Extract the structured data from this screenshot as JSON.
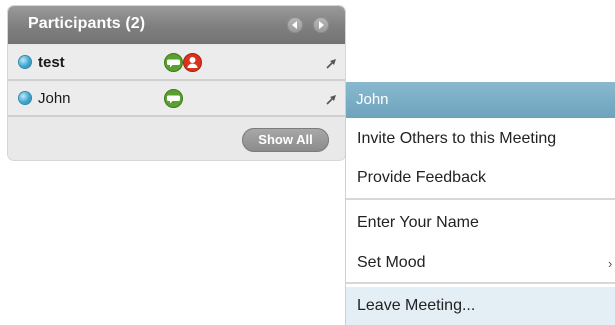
{
  "participants_panel": {
    "title": "Participants (2)",
    "participants": [
      {
        "name": "test",
        "status_icon": "presence-online-icon",
        "icons": [
          "chat-icon",
          "host-icon"
        ],
        "pin_icon": "pin-icon"
      },
      {
        "name": "John",
        "status_icon": "presence-online-icon",
        "icons": [
          "chat-icon"
        ],
        "pin_icon": "pin-icon"
      }
    ],
    "show_all_label": "Show All"
  },
  "context_menu": {
    "header": "John",
    "items": [
      {
        "label": "Invite Others to this Meeting"
      },
      {
        "label": "Provide Feedback"
      },
      {
        "label": "Enter Your Name"
      },
      {
        "label": "Set Mood",
        "submenu_indicator": "›"
      },
      {
        "label": "Leave Meeting..."
      }
    ]
  },
  "colors": {
    "panel_header": "#808080",
    "menu_header": "#7aabc4",
    "highlight_item": "#e4eef5",
    "chat_icon": "#5aa02c",
    "host_icon": "#d9331c",
    "presence": "#3fa6cf"
  }
}
